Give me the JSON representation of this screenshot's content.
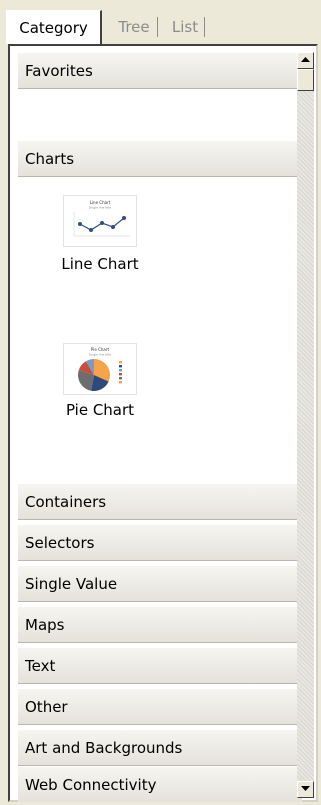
{
  "tabs": [
    {
      "label": "Category",
      "active": true
    },
    {
      "label": "Tree",
      "active": false
    },
    {
      "label": "List",
      "active": false
    }
  ],
  "sections": {
    "favorites": "Favorites",
    "charts": "Charts",
    "containers": "Containers",
    "selectors": "Selectors",
    "single_value": "Single Value",
    "maps": "Maps",
    "text": "Text",
    "other": "Other",
    "art": "Art and Backgrounds",
    "web": "Web Connectivity"
  },
  "chart_items": {
    "line": {
      "label": "Line Chart",
      "thumb_title": "Line Chart",
      "thumb_subtitle": "Single line title",
      "icon": "line-chart-icon"
    },
    "pie": {
      "label": "Pie Chart",
      "thumb_title": "Pie Chart",
      "thumb_subtitle": "Single line title",
      "icon": "pie-chart-icon"
    }
  },
  "colors": {
    "pie": [
      "#f6a34a",
      "#2e4a7d",
      "#7d9bc1",
      "#c94c3d",
      "#6d6d6d"
    ],
    "line": "#2f4f7f"
  }
}
